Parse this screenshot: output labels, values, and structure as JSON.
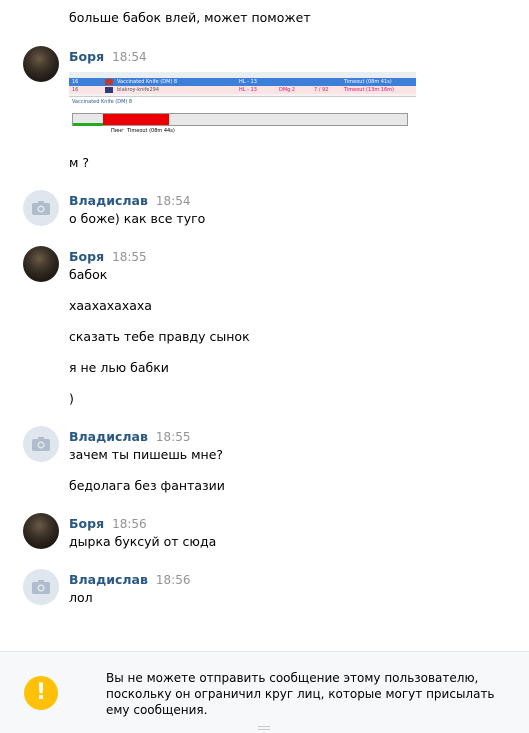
{
  "messages": {
    "m0": "больше бабок влей, может поможет",
    "g1_author": "Боря",
    "g1_time": "18:54",
    "g1_text1": "м ?",
    "g2_author": "Владислав",
    "g2_time": "18:54",
    "g2_text1": "о боже) как все туго",
    "g3_author": "Боря",
    "g3_time": "18:55",
    "g3_text1": "бабок",
    "g3_text2": "хаахахахаха",
    "g3_text3": "сказать тебе правду сынок",
    "g3_text4": "я не лью бабки",
    "g3_text5": ")",
    "g4_author": "Владислав",
    "g4_time": "18:55",
    "g4_text1": "зачем ты пишешь мне?",
    "g4_text2": "бедолага без фантазии",
    "g5_author": "Боря",
    "g5_time": "18:56",
    "g5_text1": "дырка буксуй от сюда",
    "g6_author": "Владислав",
    "g6_time": "18:56",
    "g6_text1": "лол"
  },
  "screenshot": {
    "row1_name": "Vaccinated Knife (DM) 8",
    "row1_num": "16",
    "row1_hp": "HL - 13",
    "row1_status": "Timeout (08m 41s)",
    "row2_name": "blakroy-knife294",
    "row2_num": "16",
    "row2_hp": "HL - 13",
    "row2_dmg": "DMg 2",
    "row2_score": "7 / 92",
    "row2_status": "Timeout (13m 16m)",
    "panel_title": "Vaccinated Knife (DM) 8",
    "bar_label": "Timeout (08m 44s)",
    "bar_prefix": "Пинг"
  },
  "footer": {
    "notice": "Вы не можете отправить сообщение этому пользователю, поскольку он ограничил круг лиц, которые могут присылать ему сообщения.",
    "warning_glyph": "!"
  },
  "colors": {
    "author": "#2a5885",
    "time": "#939393",
    "warning": "#ffc107"
  }
}
